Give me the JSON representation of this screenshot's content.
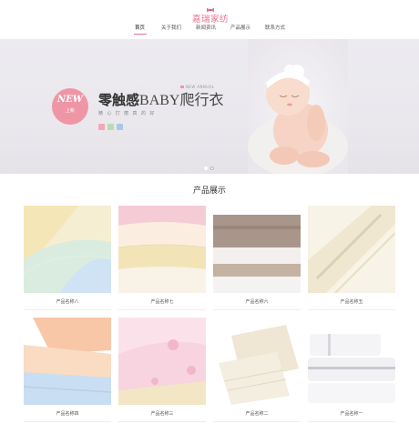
{
  "brand": {
    "logo_text": "嘉瑞家纺",
    "accent": "#e8708f"
  },
  "nav": {
    "items": [
      {
        "label": "首页",
        "active": true
      },
      {
        "label": "关于我们",
        "active": false
      },
      {
        "label": "新闻资讯",
        "active": false
      },
      {
        "label": "产品展示",
        "active": false
      },
      {
        "label": "联系方式",
        "active": false
      }
    ]
  },
  "banner": {
    "new_badge": {
      "title": "NEW",
      "sub": "上新"
    },
    "new_annual": "NEW ANNUAL",
    "headline_bold": "零触感",
    "headline_light": "BABY爬行衣",
    "tagline": "精 心 打 磨 真 的 好",
    "swatch_colors": [
      "#f4a7b7",
      "#b8dcb2",
      "#a8c8e8"
    ],
    "slide_dots": 2,
    "active_dot": 1
  },
  "products": {
    "title": "产品展示",
    "items": [
      {
        "label": "产品名称八",
        "icon": "towel-pastel-stack"
      },
      {
        "label": "产品名称七",
        "icon": "towel-pink-yellow-stack"
      },
      {
        "label": "产品名称六",
        "icon": "towel-brown-white-stack"
      },
      {
        "label": "产品名称五",
        "icon": "towel-cream-roll"
      },
      {
        "label": "产品名称四",
        "icon": "towel-peach-blue-fold"
      },
      {
        "label": "产品名称三",
        "icon": "towel-pink-floral-fold"
      },
      {
        "label": "产品名称二",
        "icon": "towel-beige-fold"
      },
      {
        "label": "产品名称一",
        "icon": "towel-white-stack"
      }
    ]
  }
}
